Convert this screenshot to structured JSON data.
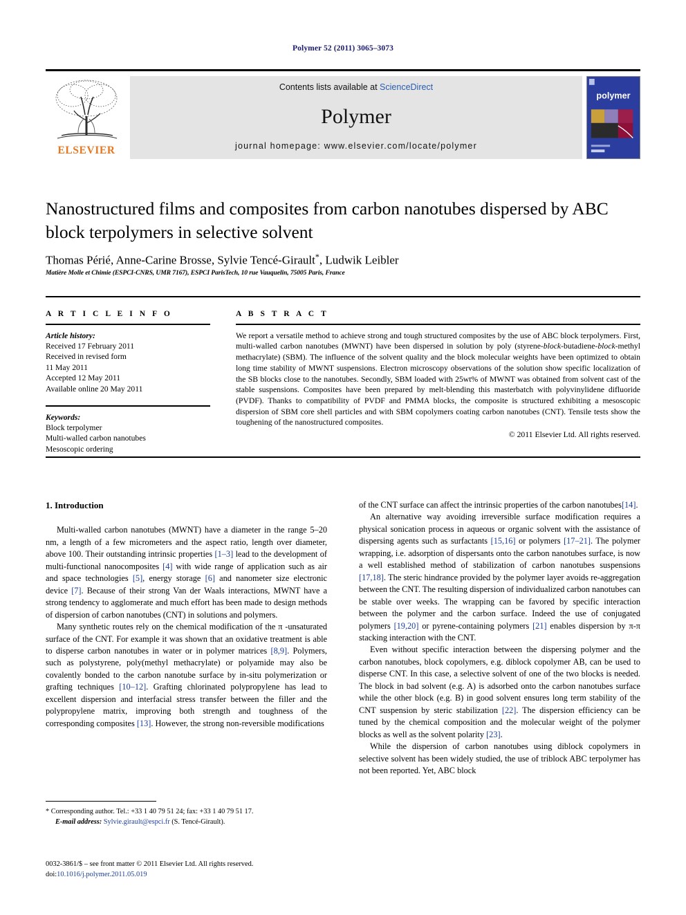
{
  "running_head": "Polymer 52 (2011) 3065–3073",
  "masthead": {
    "contents_prefix": "Contents lists available at ",
    "sciencedirect": "ScienceDirect",
    "journal_name": "Polymer",
    "homepage": "journal homepage: www.elsevier.com/locate/polymer",
    "publisher_logo_text": "ELSEVIER",
    "cover_title": "polymer",
    "link_color": "#2a5db0",
    "elsevier_orange": "#E87722",
    "cover_blue": "#2b3ea0"
  },
  "article": {
    "title": "Nanostructured films and composites from carbon nanotubes dispersed by ABC block terpolymers in selective solvent",
    "authors": "Thomas Périé, Anne-Carine Brosse, Sylvie Tencé-Girault",
    "authors_tail": ", Ludwik Leibler",
    "corresponding_marker": "*",
    "affiliation": "Matière Molle et Chimie (ESPCI-CNRS, UMR 7167), ESPCI ParisTech, 10 rue Vauquelin, 75005 Paris, France"
  },
  "article_info": {
    "heading": "A R T I C L E   I N F O",
    "history_label": "Article history:",
    "history": [
      "Received 17 February 2011",
      "Received in revised form",
      "11 May 2011",
      "Accepted 12 May 2011",
      "Available online 20 May 2011"
    ],
    "keywords_label": "Keywords:",
    "keywords": [
      "Block terpolymer",
      "Multi-walled carbon nanotubes",
      "Mesoscopic ordering"
    ]
  },
  "abstract": {
    "heading": "A B S T R A C T",
    "part1": "We report a versatile method to achieve strong and tough structured composites by the use of ABC block terpolymers. First, multi-walled carbon nanotubes (MWNT) have been dispersed in solution by poly (styrene-",
    "italic1": "block",
    "part2": "-butadiene-",
    "italic2": "block",
    "part3": "-methyl methacrylate) (SBM). The influence of the solvent quality and the block molecular weights have been optimized to obtain long time stability of MWNT suspensions. Electron microscopy observations of the solution show specific localization of the SB blocks close to the nanotubes. Secondly, SBM loaded with 25wt% of MWNT was obtained from solvent cast of the stable suspensions. Composites have been prepared by melt-blending this masterbatch with polyvinylidene difluoride (PVDF). Thanks to compatibility of PVDF and PMMA blocks, the composite is structured exhibiting a mesoscopic dispersion of SBM core shell particles and with SBM copolymers coating carbon nanotubes (CNT). Tensile tests show the toughening of the nanostructured composites.",
    "copyright": "© 2011 Elsevier Ltd. All rights reserved."
  },
  "body": {
    "section_number_title": "1.  Introduction",
    "left_paragraphs": [
      {
        "segments": [
          {
            "t": "Multi-walled carbon nanotubes (MWNT) have a diameter in the range 5–20 nm, a length of a few micrometers and the aspect ratio, length over diameter, above 100. Their outstanding intrinsic properties "
          },
          {
            "t": "[1–3]",
            "cite": true
          },
          {
            "t": " lead to the development of multi-functional nanocomposites "
          },
          {
            "t": "[4]",
            "cite": true
          },
          {
            "t": " with wide range of application such as air and space technologies "
          },
          {
            "t": "[5]",
            "cite": true
          },
          {
            "t": ", energy storage "
          },
          {
            "t": "[6]",
            "cite": true
          },
          {
            "t": " and nanometer size electronic device "
          },
          {
            "t": "[7]",
            "cite": true
          },
          {
            "t": ". Because of their strong Van der Waals interactions, MWNT have a strong tendency to agglomerate and much effort has been made to design methods of dispersion of carbon nanotubes (CNT) in solutions and polymers."
          }
        ]
      },
      {
        "segments": [
          {
            "t": "Many synthetic routes rely on the chemical modification of the π -unsaturated surface of the CNT. For example it was shown that an oxidative treatment is able to disperse carbon nanotubes in water or in polymer matrices "
          },
          {
            "t": "[8,9]",
            "cite": true
          },
          {
            "t": ". Polymers, such as polystyrene, poly(methyl methacrylate) or polyamide may also be covalently bonded to the carbon nanotube surface by in-situ polymerization or grafting techniques "
          },
          {
            "t": "[10–12]",
            "cite": true
          },
          {
            "t": ". Grafting chlorinated polypropylene has lead to excellent dispersion and interfacial stress transfer between the filler and the polypropylene matrix, improving both strength and toughness of the corresponding composites "
          },
          {
            "t": "[13]",
            "cite": true
          },
          {
            "t": ". However, the strong non-reversible modifications"
          }
        ]
      }
    ],
    "right_paragraphs": [
      {
        "no_indent": true,
        "segments": [
          {
            "t": "of the CNT surface can affect the intrinsic properties of the carbon nanotubes"
          },
          {
            "t": "[14]",
            "cite": true
          },
          {
            "t": "."
          }
        ]
      },
      {
        "segments": [
          {
            "t": "An alternative way avoiding irreversible surface modification requires a physical sonication process in aqueous or organic solvent with the assistance of dispersing agents such as surfactants "
          },
          {
            "t": "[15,16]",
            "cite": true
          },
          {
            "t": " or polymers "
          },
          {
            "t": "[17–21]",
            "cite": true
          },
          {
            "t": ". The polymer wrapping, i.e. adsorption of dispersants onto the carbon nanotubes surface, is now a well established method of stabilization of carbon nanotubes suspensions "
          },
          {
            "t": "[17,18]",
            "cite": true
          },
          {
            "t": ". The steric hindrance provided by the polymer layer avoids re-aggregation between the CNT. The resulting dispersion of individualized carbon nanotubes can be stable over weeks. The wrapping can be favored by specific interaction between the polymer and the carbon surface. Indeed the use of conjugated polymers "
          },
          {
            "t": "[19,20]",
            "cite": true
          },
          {
            "t": " or pyrene-containing polymers "
          },
          {
            "t": "[21]",
            "cite": true
          },
          {
            "t": " enables dispersion by π-π stacking interaction with the CNT."
          }
        ]
      },
      {
        "segments": [
          {
            "t": "Even without specific interaction between the dispersing polymer and the carbon nanotubes, block copolymers, e.g. diblock copolymer AB, can be used to disperse CNT. In this case, a selective solvent of one of the two blocks is needed. The block in bad solvent (e.g. A) is adsorbed onto the carbon nanotubes surface while the other block (e.g. B) in good solvent ensures long term stability of the CNT suspension by steric stabilization "
          },
          {
            "t": "[22]",
            "cite": true
          },
          {
            "t": ". The dispersion efficiency can be tuned by the chemical composition and the molecular weight of the polymer blocks as well as the solvent polarity "
          },
          {
            "t": "[23]",
            "cite": true
          },
          {
            "t": "."
          }
        ]
      },
      {
        "segments": [
          {
            "t": "While the dispersion of carbon nanotubes using diblock copolymers in selective solvent has been widely studied, the use of triblock ABC terpolymer has not been reported. Yet, ABC block"
          }
        ]
      }
    ]
  },
  "footnote": {
    "line1": "* Corresponding author. Tel.: +33 1 40 79 51 24; fax: +33 1 40 79 51 17.",
    "email_label": "E-mail address:",
    "email": "Sylvie.girault@espci.fr",
    "email_owner": " (S. Tencé-Girault)."
  },
  "page_footer": {
    "line1": "0032-3861/$ – see front matter © 2011 Elsevier Ltd. All rights reserved.",
    "doi_label": "doi:",
    "doi": "10.1016/j.polymer.2011.05.019"
  }
}
